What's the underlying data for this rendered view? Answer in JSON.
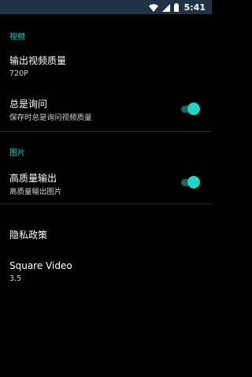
{
  "status_bar": {
    "time": "5:41",
    "icons": [
      "wifi-icon",
      "cellular-signal-icon",
      "battery-icon"
    ],
    "background": "#223246"
  },
  "sections": {
    "video": {
      "header": "视频",
      "output_quality": {
        "title": "输出视频质量",
        "value": "720P"
      },
      "always_ask": {
        "title": "总是询问",
        "subtitle": "保存时总是询问视频质量",
        "enabled": true
      }
    },
    "image": {
      "header": "图片",
      "high_quality_output": {
        "title": "高质量输出",
        "subtitle": "高质量输出图片",
        "enabled": true
      }
    },
    "about": {
      "privacy_policy": {
        "title": "隐私政策"
      },
      "app_info": {
        "title": "Square Video",
        "version": "3.5"
      }
    }
  },
  "colors": {
    "accent": "#28d2c5",
    "toggle_thumb": "#23d3c4",
    "toggle_track": "#196963",
    "background": "#000000"
  }
}
